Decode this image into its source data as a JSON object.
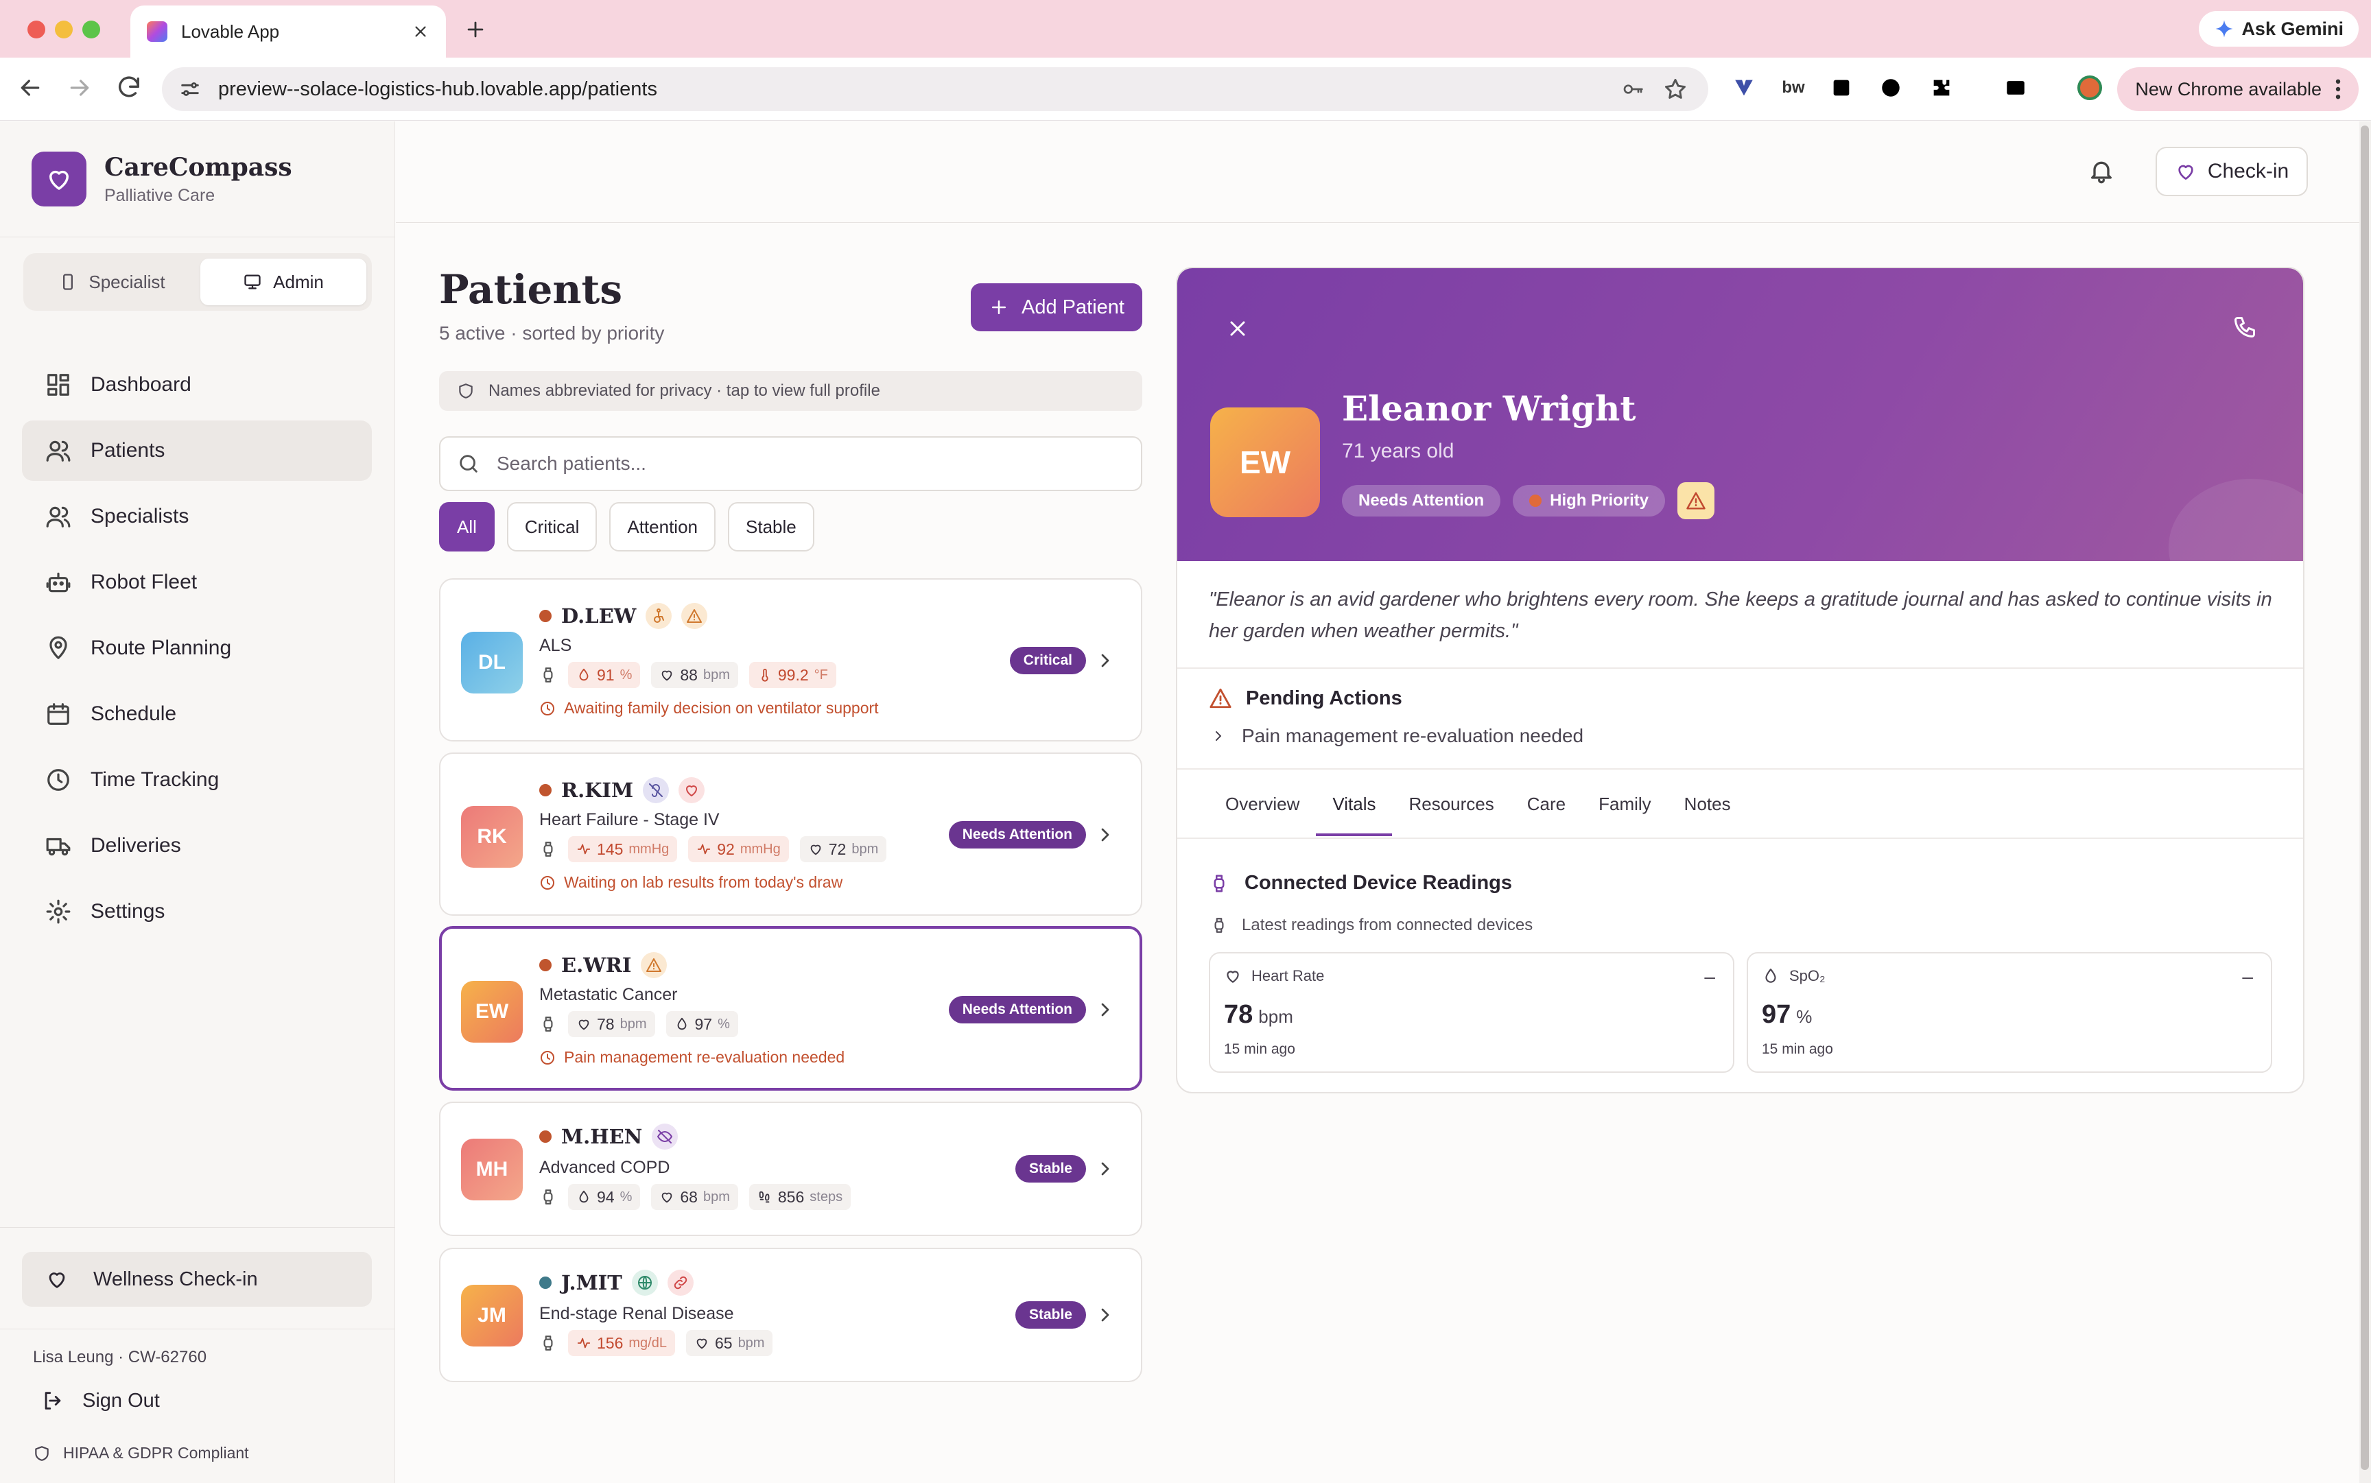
{
  "browser": {
    "tab_title": "Lovable App",
    "url": "preview--solace-logistics-hub.lovable.app/patients",
    "ask_gemini": "Ask Gemini",
    "new_chrome": "New Chrome available",
    "ext_bw": "bw"
  },
  "sidebar": {
    "brand_name": "CareCompass",
    "brand_sub": "Palliative Care",
    "role_specialist": "Specialist",
    "role_admin": "Admin",
    "nav": [
      {
        "label": "Dashboard",
        "icon": "dashboard-icon"
      },
      {
        "label": "Patients",
        "icon": "users-icon"
      },
      {
        "label": "Specialists",
        "icon": "users-icon"
      },
      {
        "label": "Robot Fleet",
        "icon": "robot-icon"
      },
      {
        "label": "Route Planning",
        "icon": "map-pin-icon"
      },
      {
        "label": "Schedule",
        "icon": "calendar-icon"
      },
      {
        "label": "Time Tracking",
        "icon": "clock-icon"
      },
      {
        "label": "Deliveries",
        "icon": "truck-icon"
      },
      {
        "label": "Settings",
        "icon": "gear-icon"
      }
    ],
    "wellness": "Wellness Check-in",
    "user": "Lisa Leung · CW-62760",
    "sign_out": "Sign Out",
    "compliance": "HIPAA & GDPR Compliant"
  },
  "header": {
    "checkin": "Check-in"
  },
  "patients": {
    "title": "Patients",
    "subtitle": "5 active · sorted by priority",
    "add_button": "Add Patient",
    "privacy_note": "Names abbreviated for privacy · tap to view full profile",
    "search_placeholder": "Search patients...",
    "filters": [
      "All",
      "Critical",
      "Attention",
      "Stable"
    ],
    "list": [
      {
        "initials": "DL",
        "name": "D.LEW",
        "diagnosis": "ALS",
        "status": "Critical",
        "v1": "91",
        "v1u": "%",
        "v2": "88",
        "v2u": "bpm",
        "v3": "99.2",
        "v3u": "°F",
        "note": "Awaiting family decision on ventilator support"
      },
      {
        "initials": "RK",
        "name": "R.KIM",
        "diagnosis": "Heart Failure - Stage IV",
        "status": "Needs Attention",
        "v1": "145",
        "v1u": "mmHg",
        "v2": "92",
        "v2u": "mmHg",
        "v3": "72",
        "v3u": "bpm",
        "note": "Waiting on lab results from today's draw"
      },
      {
        "initials": "EW",
        "name": "E.WRI",
        "diagnosis": "Metastatic Cancer",
        "status": "Needs Attention",
        "v1": "78",
        "v1u": "bpm",
        "v2": "97",
        "v2u": "%",
        "note": "Pain management re-evaluation needed"
      },
      {
        "initials": "MH",
        "name": "M.HEN",
        "diagnosis": "Advanced COPD",
        "status": "Stable",
        "v1": "94",
        "v1u": "%",
        "v2": "68",
        "v2u": "bpm",
        "v3": "856",
        "v3u": "steps"
      },
      {
        "initials": "JM",
        "name": "J.MIT",
        "diagnosis": "End-stage Renal Disease",
        "status": "Stable",
        "v1": "156",
        "v1u": "mg/dL",
        "v2": "65",
        "v2u": "bpm"
      }
    ]
  },
  "detail": {
    "initials": "EW",
    "name": "Eleanor Wright",
    "age": "71 years old",
    "tag_attention": "Needs Attention",
    "tag_priority": "High Priority",
    "quote": "\"Eleanor is an avid gardener who brightens every room. She keeps a gratitude journal and has asked to continue visits in her garden when weather permits.\"",
    "pending_title": "Pending Actions",
    "pending_item": "Pain management re-evaluation needed",
    "tabs": [
      "Overview",
      "Vitals",
      "Resources",
      "Care",
      "Family",
      "Notes"
    ],
    "readings_title": "Connected Device Readings",
    "readings_sub": "Latest readings from connected devices",
    "readings": [
      {
        "label": "Heart Rate",
        "value": "78",
        "unit": "bpm",
        "ago": "15 min ago",
        "minus": "–"
      },
      {
        "label": "SpO₂",
        "value": "97",
        "unit": "%",
        "ago": "15 min ago",
        "minus": "–"
      }
    ]
  },
  "colors": {
    "accent": "#7a3ea6",
    "critical_dot": "#c0552e",
    "stable_dot": "#3f7a8a"
  }
}
